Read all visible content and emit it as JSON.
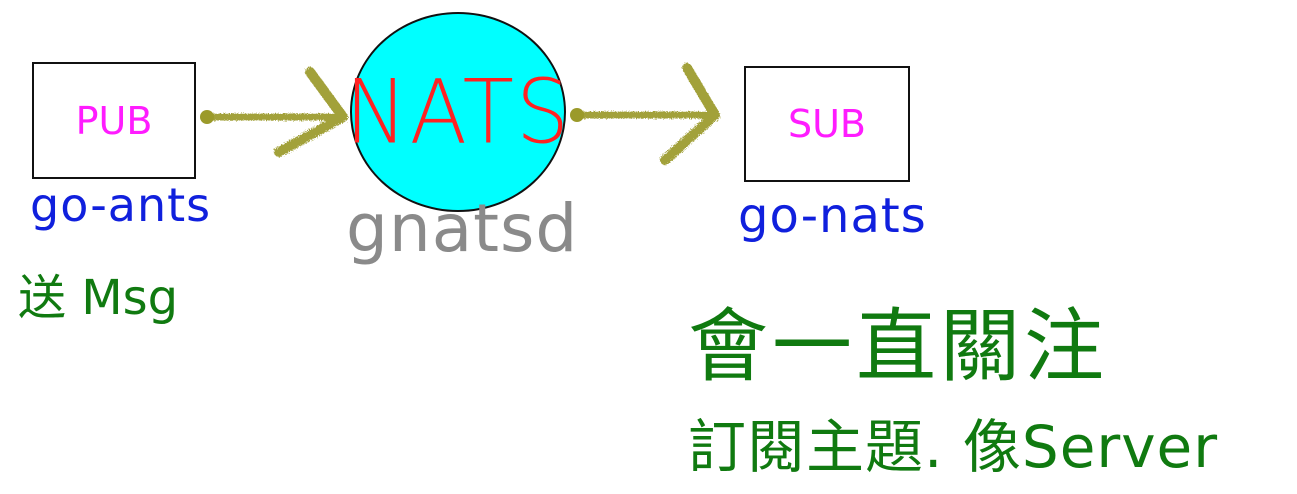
{
  "nodes": {
    "publisher": {
      "label": "PUB",
      "client": "go-ants",
      "action": "送 Msg"
    },
    "server": {
      "label": "NATS",
      "name": "gnatsd"
    },
    "subscriber": {
      "label": "SUB",
      "client": "go-nats",
      "note_line1": "會一直關注",
      "note_line2": "訂閱主題. 像Server"
    }
  },
  "colors": {
    "node_label": "#ff1cff",
    "server_fill": "#00ffff",
    "server_label": "#ff2222",
    "arrow": "#9b9a2a",
    "client_text": "#1020dd",
    "note_text": "#107a10",
    "server_name": "#8a8a8a"
  },
  "edges": [
    {
      "from": "publisher",
      "to": "server"
    },
    {
      "from": "server",
      "to": "subscriber"
    }
  ]
}
